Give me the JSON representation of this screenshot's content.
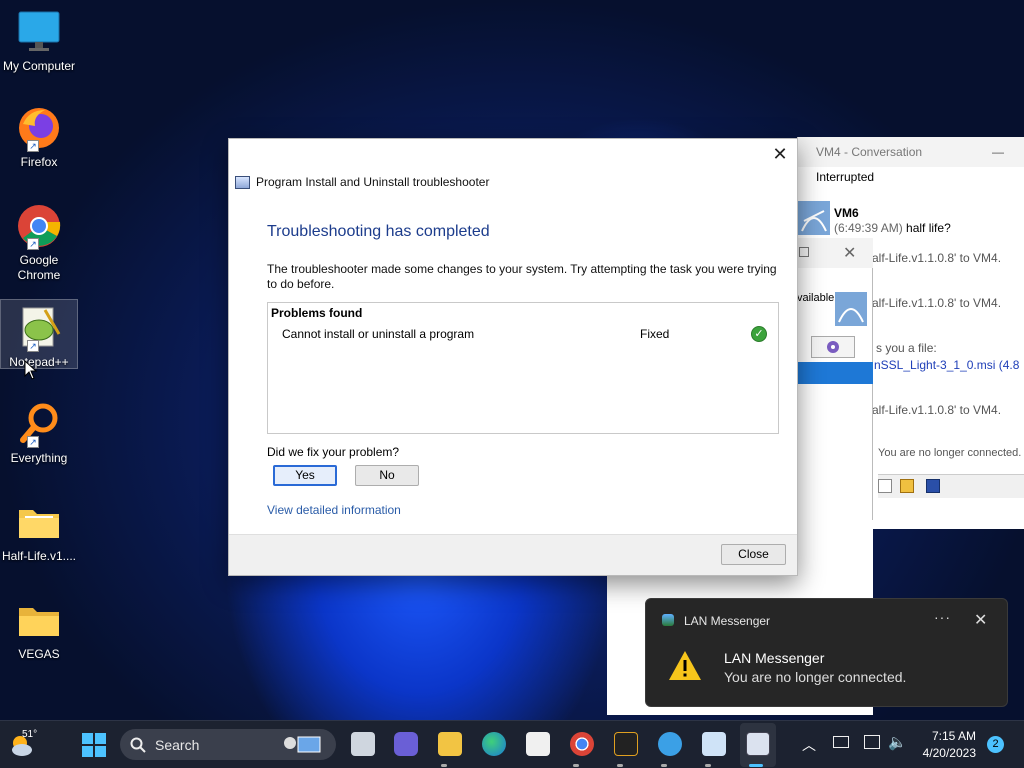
{
  "desktop": {
    "icons": [
      {
        "label": "My Computer"
      },
      {
        "label": "Firefox"
      },
      {
        "label": "Google Chrome"
      },
      {
        "label": "Notepad++"
      },
      {
        "label": "Everything"
      },
      {
        "label": "Half-Life.v1...."
      },
      {
        "label": "VEGAS"
      }
    ]
  },
  "conversation": {
    "title": "VM4 - Conversation",
    "minimize": "—",
    "status": "Interrupted",
    "sender": "VM6",
    "time": "(6:49:39 AM)",
    "message": "half life?",
    "lines": [
      "alf-Life.v1.1.0.8' to VM4.",
      "alf-Life.v1.1.0.8' to VM4.",
      "s you a file:",
      "nSSL_Light-3_1_0.msi (4.8",
      "alf-Life.v1.1.0.8' to VM4.",
      "You are no longer connected."
    ],
    "available_label": "vailable"
  },
  "dialog": {
    "title": "Program Install and Uninstall troubleshooter",
    "close": "✕",
    "heading": "Troubleshooting has completed",
    "description": "The troubleshooter made some changes to your system. Try attempting the task you were trying to do before.",
    "problems_header": "Problems found",
    "problem": {
      "name": "Cannot install or uninstall a program",
      "status": "Fixed"
    },
    "question": "Did we fix your problem?",
    "yes": "Yes",
    "no": "No",
    "details_link": "View detailed information",
    "close_button": "Close"
  },
  "toast": {
    "app": "LAN Messenger",
    "more": "···",
    "close": "✕",
    "title": "LAN Messenger",
    "message": "You are no longer connected."
  },
  "taskbar": {
    "weather_temp": "51°",
    "search_label": "Search",
    "time": "7:15 AM",
    "date": "4/20/2023",
    "notification_count": "2"
  }
}
